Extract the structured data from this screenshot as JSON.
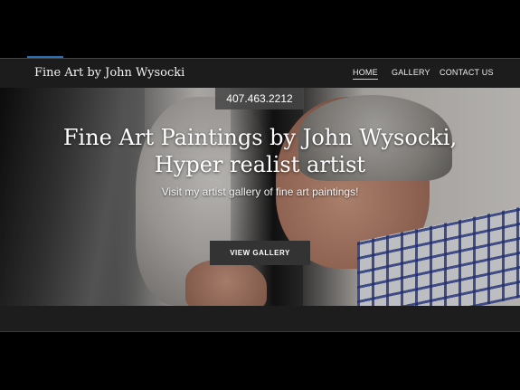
{
  "header": {
    "brand": "Fine Art by John Wysocki",
    "nav": [
      {
        "label": "HOME",
        "active": true
      },
      {
        "label": "GALLERY",
        "active": false
      },
      {
        "label": "CONTACT US",
        "active": false
      }
    ]
  },
  "hero": {
    "phone": "407.463.2212",
    "title_line1": "Fine Art Paintings by John Wysocki,",
    "title_line2": "Hyper realist artist",
    "subtitle": "Visit my artist gallery of fine art paintings!",
    "cta_label": "VIEW GALLERY"
  },
  "colors": {
    "nav_bg": "#1c1c1c",
    "cta_bg": "#333333",
    "accent": "#2a72b8"
  }
}
